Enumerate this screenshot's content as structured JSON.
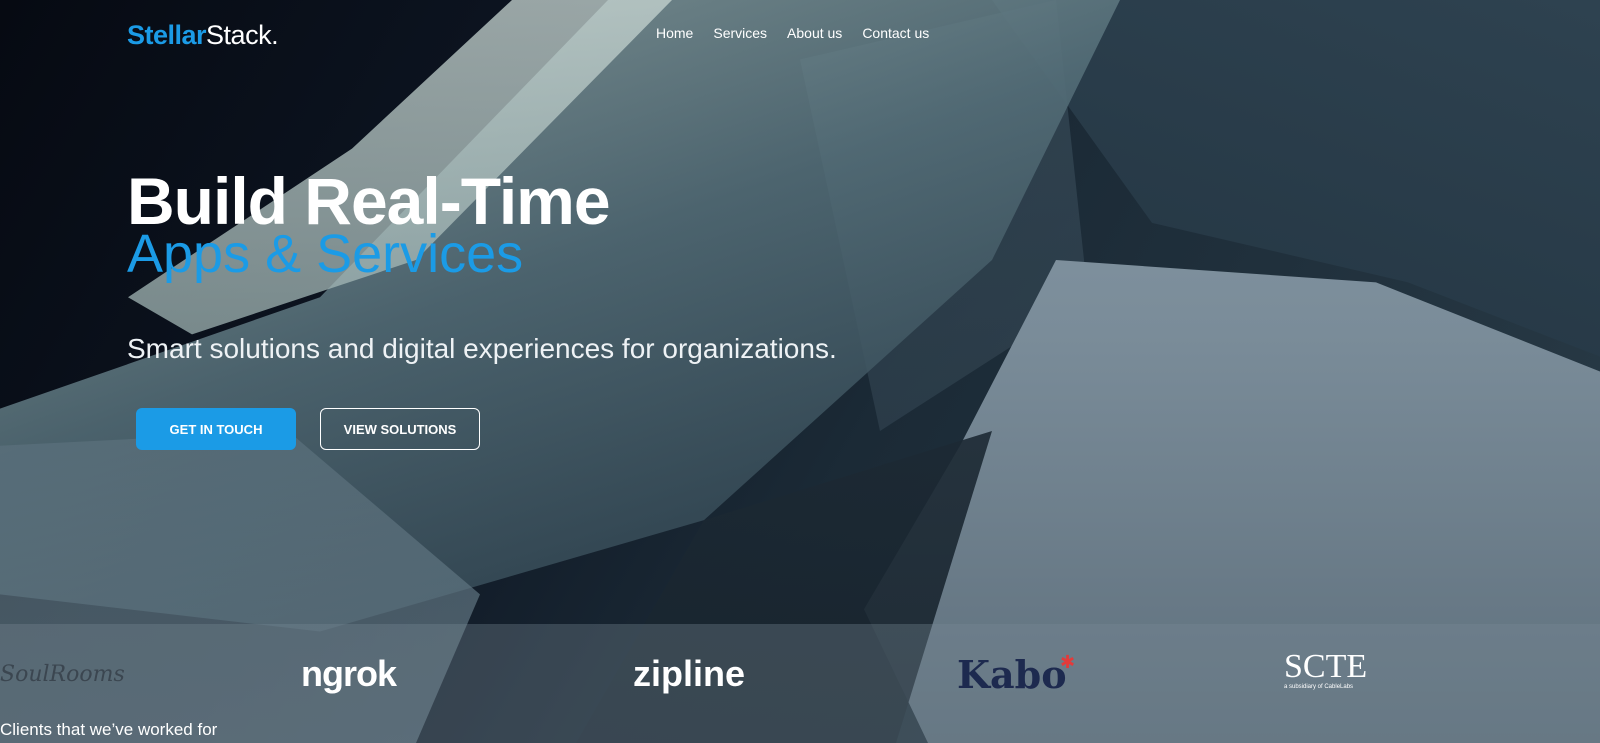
{
  "brand": {
    "name_part1": "Stellar",
    "name_part2": "Stack.",
    "accent_color": "#1b9be6"
  },
  "nav": {
    "items": [
      {
        "label": "Home"
      },
      {
        "label": "Services"
      },
      {
        "label": "About us"
      },
      {
        "label": "Contact us"
      }
    ]
  },
  "hero": {
    "title_line1": "Build Real-Time",
    "title_line2": "Apps & Services",
    "subtitle": "Smart solutions and digital experiences for organizations.",
    "primary_button": "GET IN TOUCH",
    "secondary_button": "VIEW SOLUTIONS"
  },
  "clients": {
    "caption": "Clients that we’ve worked for",
    "logos": [
      {
        "name": "SoulRooms",
        "text": "SoulRooms"
      },
      {
        "name": "ngrok",
        "text": "ngrok"
      },
      {
        "name": "zipline",
        "text": "zipline"
      },
      {
        "name": "Kabo",
        "text": "Kabo"
      },
      {
        "name": "SCTE",
        "text": "SCTE",
        "subtext": "a subsidiary of CableLabs"
      }
    ]
  }
}
